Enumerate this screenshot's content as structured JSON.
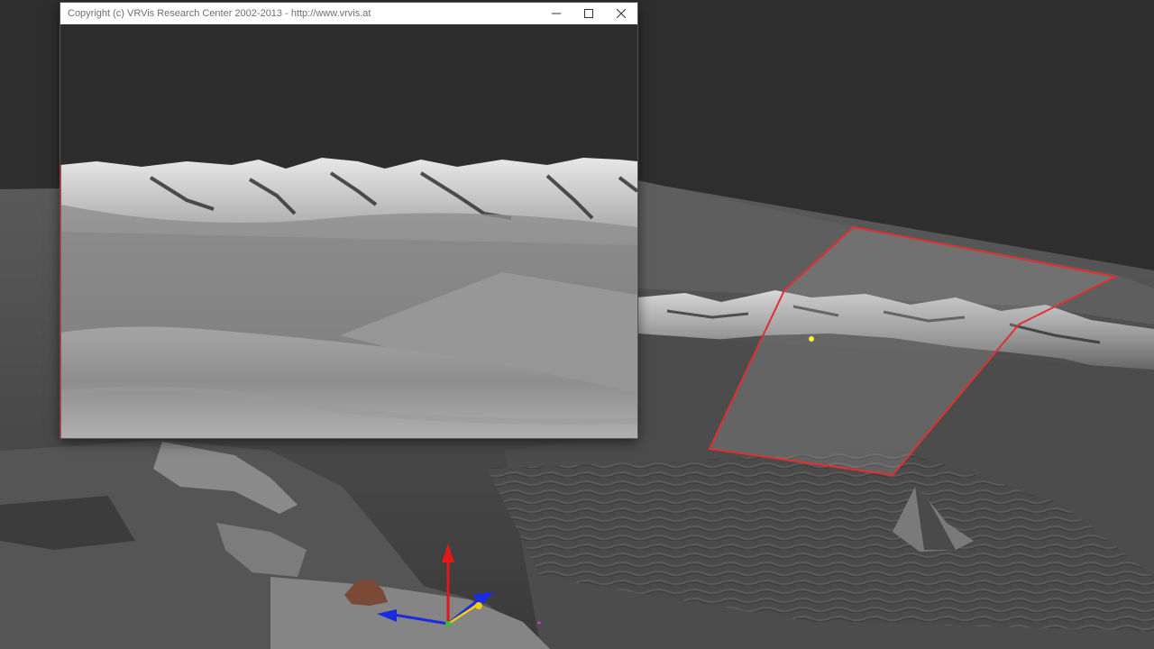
{
  "window": {
    "title": "Copyright (c) VRVis Research Center 2002-2013 - http://www.vrvis.at",
    "minimize_icon": "minimize-icon",
    "maximize_icon": "maximize-icon",
    "close_icon": "close-icon"
  },
  "scene": {
    "background_color": "#2e2e2e",
    "frustum_color": "#e03030",
    "pick_point_color": "#f5f533",
    "gizmo": {
      "z_axis_color": "#e01818",
      "x_axis_color": "#1a2cdd",
      "y_axis_color": "#f0d000",
      "icon": "transform-gizmo-icon"
    }
  }
}
